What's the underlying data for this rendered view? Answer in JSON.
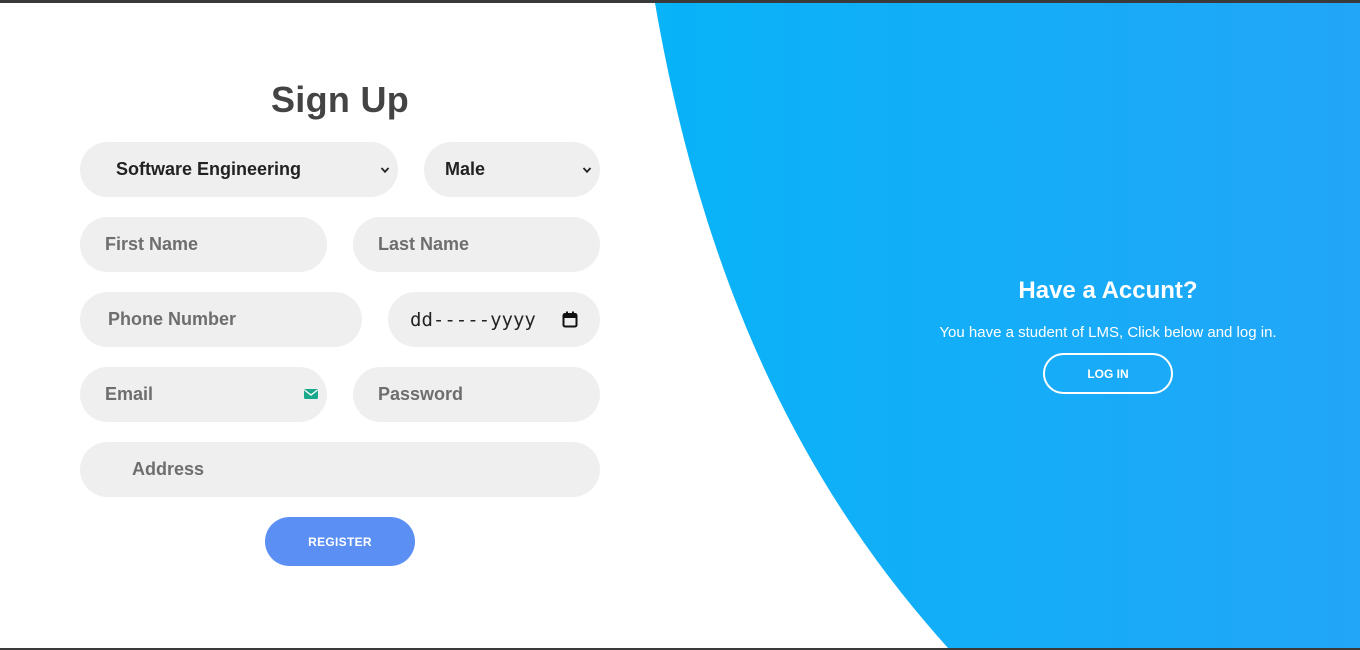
{
  "signup": {
    "title": "Sign Up",
    "department": {
      "selected": "Software Engineering"
    },
    "gender": {
      "selected": "Male"
    },
    "first_name": {
      "placeholder": "First Name"
    },
    "last_name": {
      "placeholder": "Last Name"
    },
    "phone": {
      "placeholder": "Phone Number"
    },
    "dob": {
      "placeholder": "dd-----yyyy"
    },
    "email": {
      "placeholder": "Email",
      "icon": "envelope-icon"
    },
    "password": {
      "placeholder": "Password"
    },
    "address": {
      "placeholder": "Address"
    },
    "register_label": "REGISTER"
  },
  "side_panel": {
    "title": "Have a Accunt?",
    "text": "You have a student of LMS, Click below and log in.",
    "login_label": "LOG IN"
  },
  "colors": {
    "panel_blue_start": "#08b3f8",
    "panel_blue_end": "#22a6f7",
    "input_bg": "#efefef",
    "register_blue": "#5b8ff4",
    "title_gray": "#444444"
  }
}
